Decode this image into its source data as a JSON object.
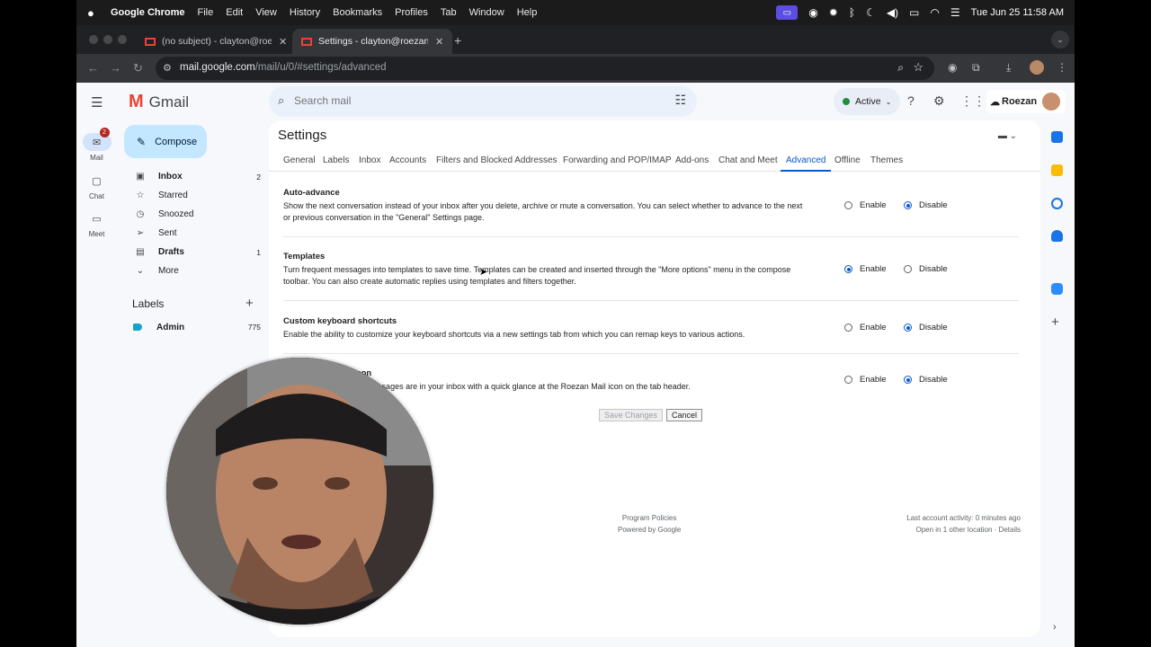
{
  "menubar": {
    "app": "Google Chrome",
    "items": [
      "File",
      "Edit",
      "View",
      "History",
      "Bookmarks",
      "Profiles",
      "Tab",
      "Window",
      "Help"
    ],
    "datetime": "Tue Jun 25  11:58 AM"
  },
  "browser": {
    "tabs": [
      {
        "title": "(no subject) - clayton@roezan"
      },
      {
        "title": "Settings - clayton@roezan.co"
      }
    ],
    "url_host": "mail.google.com",
    "url_path": "/mail/u/0/#settings/advanced"
  },
  "gmail": {
    "logo": "Gmail",
    "search_placeholder": "Search mail",
    "status": "Active",
    "brand": "Roezan",
    "compose": "Compose",
    "rail": [
      {
        "label": "Mail",
        "badge": "2"
      },
      {
        "label": "Chat"
      },
      {
        "label": "Meet"
      }
    ],
    "nav": [
      {
        "label": "Inbox",
        "count": "2",
        "bold": true
      },
      {
        "label": "Starred",
        "count": ""
      },
      {
        "label": "Snoozed",
        "count": ""
      },
      {
        "label": "Sent",
        "count": ""
      },
      {
        "label": "Drafts",
        "count": "1",
        "bold": true
      },
      {
        "label": "More",
        "count": ""
      }
    ],
    "labels_title": "Labels",
    "labels": [
      {
        "label": "Admin",
        "count": "775"
      }
    ]
  },
  "settings": {
    "title": "Settings",
    "tabs": [
      "General",
      "Labels",
      "Inbox",
      "Accounts",
      "Filters and Blocked Addresses",
      "Forwarding and POP/IMAP",
      "Add-ons",
      "Chat and Meet",
      "Advanced",
      "Offline",
      "Themes"
    ],
    "active_tab": "Advanced",
    "sections": [
      {
        "heading": "Auto-advance",
        "description": "Show the next conversation instead of your inbox after you delete, archive or mute a conversation. You can select whether to advance to the next or previous conversation in the \"General\" Settings page.",
        "value": "Disable"
      },
      {
        "heading": "Templates",
        "description": "Turn frequent messages into templates to save time. Templates can be created and inserted through the \"More options\" menu in the compose toolbar. You can also create automatic replies using templates and filters together.",
        "value": "Enable"
      },
      {
        "heading": "Custom keyboard shortcuts",
        "description": "Enable the ability to customize your keyboard shortcuts via a new settings tab from which you can remap keys to various actions.",
        "value": "Disable"
      },
      {
        "heading": "Unread message icon",
        "description": "See how many unread messages are in your inbox with a quick glance at the Roezan Mail icon on the tab header.",
        "value": "Disable"
      }
    ],
    "enable_label": "Enable",
    "disable_label": "Disable",
    "save_label": "Save Changes",
    "cancel_label": "Cancel",
    "footer_center": [
      "Program Policies",
      "Powered by Google"
    ],
    "footer_right": [
      "Last account activity: 0 minutes ago",
      "Open in 1 other location · Details"
    ]
  }
}
